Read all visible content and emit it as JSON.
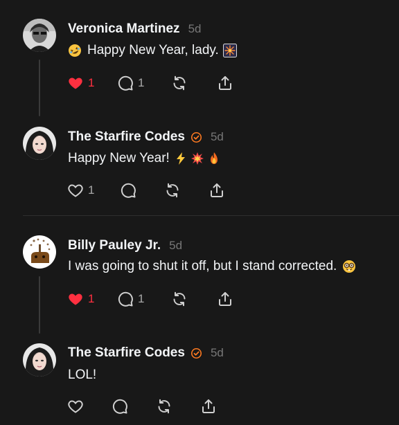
{
  "colors": {
    "background": "#181818",
    "text": "#f3f5f7",
    "muted": "#777777",
    "like_active": "#ff3040",
    "verified": "#ff7a21"
  },
  "posts": [
    {
      "username": "Veronica Martinez",
      "time": "5d",
      "verified": false,
      "text": "Happy New Year, lady.",
      "emojis": [
        "rofl-emoji",
        "fireworks-emoji"
      ],
      "likes": "1",
      "liked": true,
      "replies": "1"
    },
    {
      "username": "The Starfire Codes",
      "time": "5d",
      "verified": true,
      "text": "Happy New Year!",
      "emojis": [
        "lightning-emoji",
        "collision-emoji",
        "fire-emoji"
      ],
      "likes": "1",
      "liked": false,
      "replies": ""
    },
    {
      "username": "Billy Pauley Jr.",
      "time": "5d",
      "verified": false,
      "text": "I was going to shut it off, but I stand corrected.",
      "emojis": [
        "nerd-face-emoji"
      ],
      "likes": "1",
      "liked": true,
      "replies": "1"
    },
    {
      "username": "The Starfire Codes",
      "time": "5d",
      "verified": true,
      "text": "LOL!",
      "emojis": [],
      "likes": "",
      "liked": false,
      "replies": ""
    }
  ]
}
